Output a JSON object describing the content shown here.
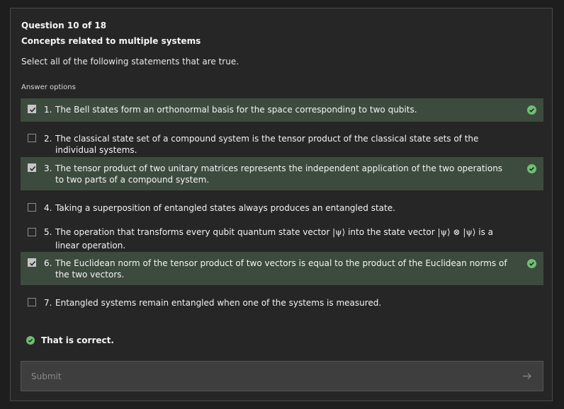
{
  "question": {
    "number_label": "Question 10 of 18",
    "title": "Concepts related to multiple systems",
    "prompt": "Select all of the following statements that are true."
  },
  "answer_options_label": "Answer options",
  "options": [
    {
      "num": "1.",
      "selected": true,
      "correct_icon": "check-circle-icon",
      "text": "The Bell states form an orthonormal basis for the space corresponding to two qubits."
    },
    {
      "num": "2.",
      "selected": false,
      "text": "The classical state set of a compound system is the tensor product of the classical state sets of the individual systems."
    },
    {
      "num": "3.",
      "selected": true,
      "correct_icon": "check-circle-icon",
      "text": "The tensor product of two unitary matrices represents the independent application of the two operations to two parts of a compound system."
    },
    {
      "num": "4.",
      "selected": false,
      "text": "Taking a superposition of entangled states always produces an entangled state."
    },
    {
      "num": "5.",
      "selected": false,
      "text_a": "The operation that transforms every qubit quantum state vector ",
      "math_a": "|ψ⟩",
      "text_b": " into the state vector ",
      "math_b": "|ψ⟩ ⊗ |ψ⟩",
      "text_c": " is a linear operation."
    },
    {
      "num": "6.",
      "selected": true,
      "correct_icon": "check-circle-icon",
      "text": "The Euclidean norm of the tensor product of two vectors is equal to the product of the Euclidean norms of the two vectors."
    },
    {
      "num": "7.",
      "selected": false,
      "text": "Entangled systems remain entangled when one of the systems is measured."
    }
  ],
  "feedback": {
    "text": "That is correct.",
    "icon": "check-circle-icon"
  },
  "submit": {
    "label": "Submit",
    "icon": "arrow-right-icon"
  },
  "colors": {
    "selected_row_bg": "#3d4b3e",
    "success_green": "#6fbf73",
    "card_bg": "#262626",
    "page_bg": "#1e1e1e"
  }
}
